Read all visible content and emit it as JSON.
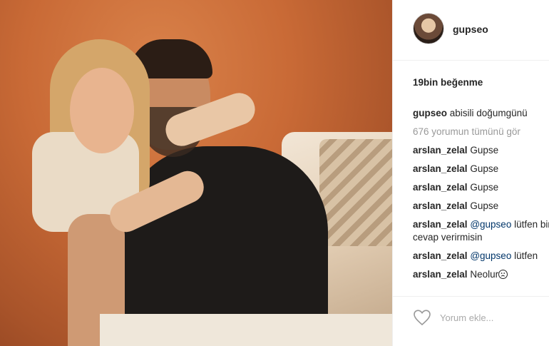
{
  "post": {
    "username": "gupseo",
    "likes": "19bin beğenme",
    "caption_user": "gupseo",
    "caption_text": "abisili doğumgünü",
    "view_all": "676 yorumun tümünü gör",
    "comments": [
      {
        "user": "arslan_zelal",
        "text": "Gupse"
      },
      {
        "user": "arslan_zelal",
        "text": "Gupse"
      },
      {
        "user": "arslan_zelal",
        "text": "Gupse"
      },
      {
        "user": "arslan_zelal",
        "text": "Gupse"
      },
      {
        "user": "arslan_zelal",
        "mention": "@gupseo",
        "text": "lütfen bir kere cevap verirmisin"
      },
      {
        "user": "arslan_zelal",
        "mention": "@gupseo",
        "text": "lütfen"
      },
      {
        "user": "arslan_zelal",
        "text": "Neolur"
      }
    ],
    "comment_placeholder": "Yorum ekle...",
    "icons": {
      "like": "heart-icon",
      "sad": "sad-face-emoji"
    }
  }
}
